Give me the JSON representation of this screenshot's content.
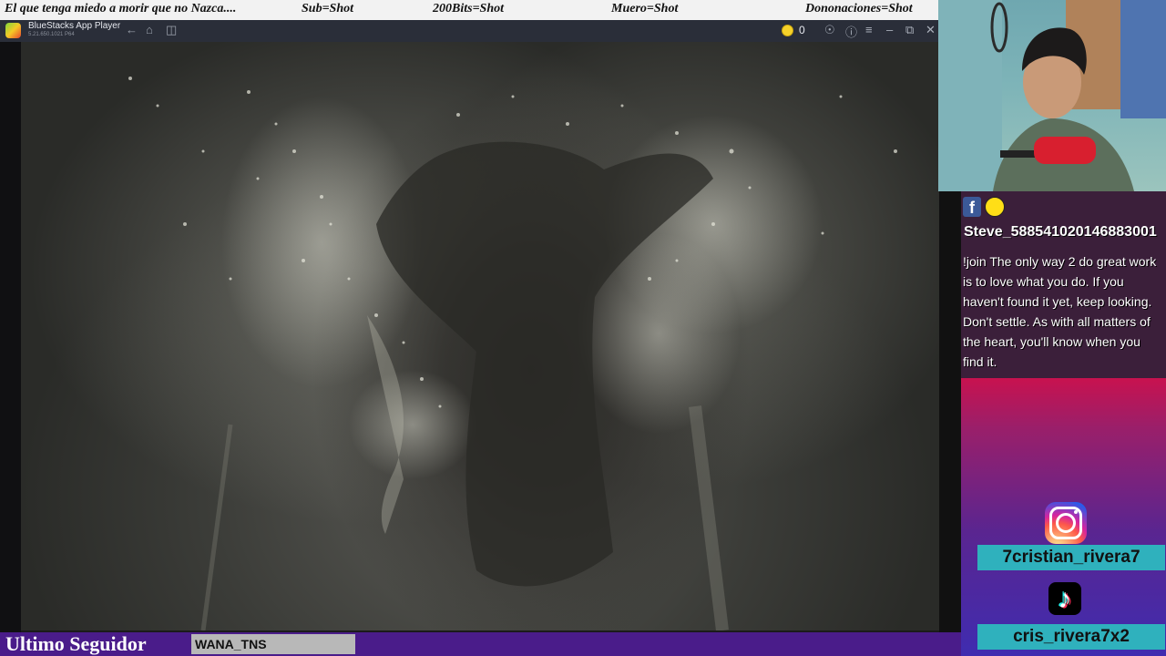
{
  "ticker": {
    "items": [
      "El que tenga miedo a morir que no Nazca....",
      "Sub=Shot",
      "200Bits=Shot",
      "Muero=Shot",
      "Dononaciones=Shot"
    ]
  },
  "emulator": {
    "app_title": "BlueStacks App Player",
    "version": "5.21.650.1021 P64",
    "coin_count": "0",
    "icons": [
      "back-icon",
      "home-icon",
      "recent-apps-icon",
      "coin-icon",
      "account-icon",
      "help-icon",
      "menu-icon",
      "minimize-icon",
      "restore-icon",
      "close-icon"
    ]
  },
  "chat": {
    "username": "Steve_588541020146883001",
    "message": "!join The only way 2 do great work is to love what you do. If you haven't found it yet, keep looking. Don't settle. As with all matters of the heart, you'll know when you find it."
  },
  "socials": {
    "instagram_handle": "7cristian_rivera7",
    "tiktok_handle": "cris_rivera7x2"
  },
  "follower": {
    "label": "Ultimo Seguidor",
    "name": "WANA_TNS"
  },
  "colors": {
    "ticker_bg": "#f2f2f2",
    "emulator_bar": "#2a2e39",
    "handle_bg": "#2fb1bd",
    "follower_bar": "#4a1c8a"
  }
}
